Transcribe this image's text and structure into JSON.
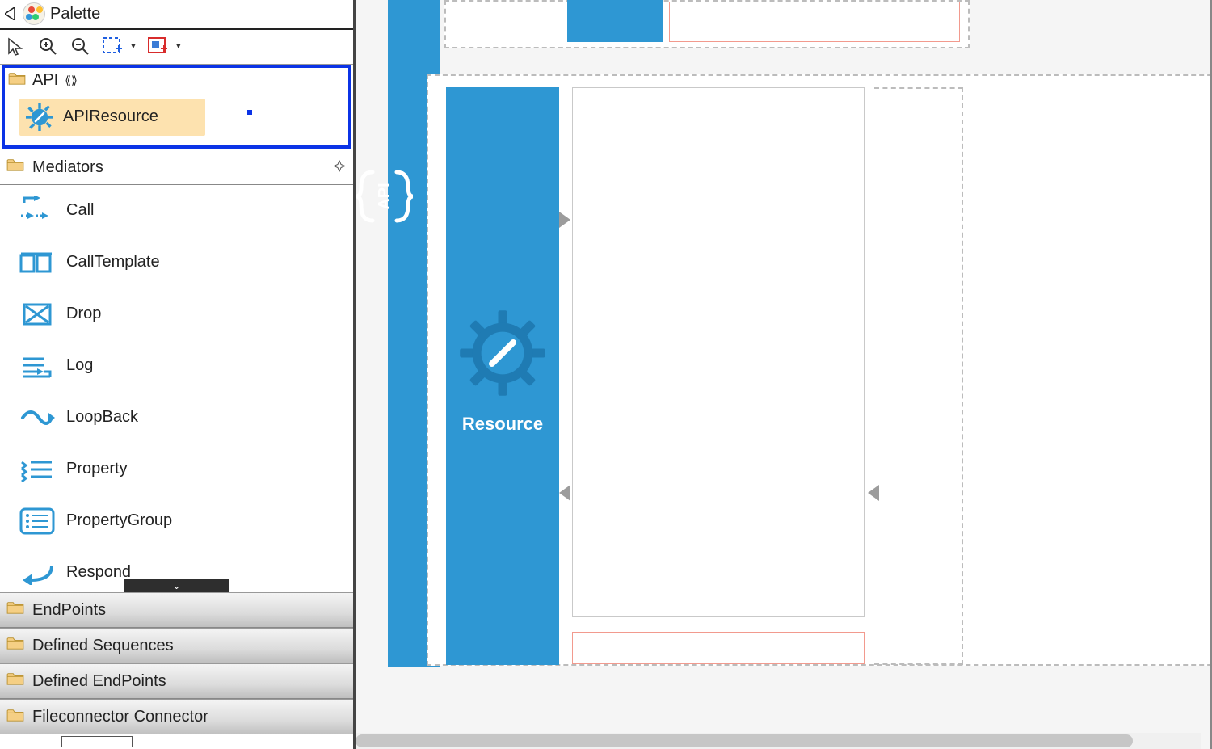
{
  "palette": {
    "title": "Palette",
    "categories": {
      "api": {
        "label": "API",
        "item": "APIResource"
      },
      "mediators": {
        "label": "Mediators",
        "items": [
          "Call",
          "CallTemplate",
          "Drop",
          "Log",
          "LoopBack",
          "Property",
          "PropertyGroup",
          "Respond"
        ]
      },
      "endpoints": "EndPoints",
      "defined_sequences": "Defined Sequences",
      "defined_endpoints": "Defined EndPoints",
      "fileconnector": "Fileconnector Connector"
    }
  },
  "canvas": {
    "api_handle": "API",
    "resource_label": "Resource"
  },
  "colors": {
    "accent_blue": "#2e97d3",
    "highlight_border": "#0b33e6",
    "selection_bg": "#fde2af",
    "red_outline": "#f29a8e"
  }
}
